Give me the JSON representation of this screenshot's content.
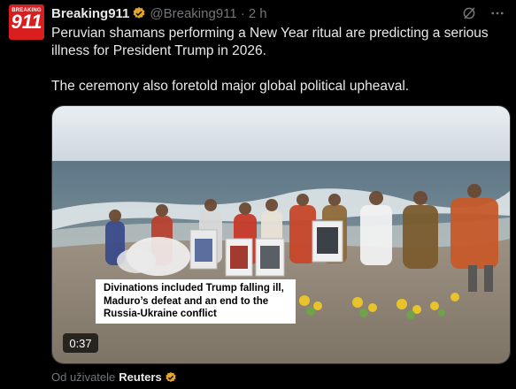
{
  "account": {
    "avatar_small": "BREAKING",
    "avatar_big": "911",
    "display_name": "Breaking911",
    "handle": "@Breaking911",
    "separator": "·",
    "time": "2 h"
  },
  "tweet": {
    "paragraph1": "Peruvian shamans performing a New Year ritual are predicting a serious illness for President Trump in 2026.",
    "paragraph2": "The ceremony also foretold major global political upheaval."
  },
  "media": {
    "caption": "Divinations included Trump falling ill, Maduro’s defeat and an end to the Russia-Ukraine conflict",
    "duration": "0:37"
  },
  "source": {
    "prefix": "Od uživatele",
    "name": "Reuters"
  },
  "icons": {
    "verified": "verified-badge-icon",
    "grok": "grok-icon",
    "more": "more-options-icon"
  },
  "colors": {
    "background": "#000000",
    "verified": "#e2a52b",
    "avatar_red": "#d81e1e"
  }
}
